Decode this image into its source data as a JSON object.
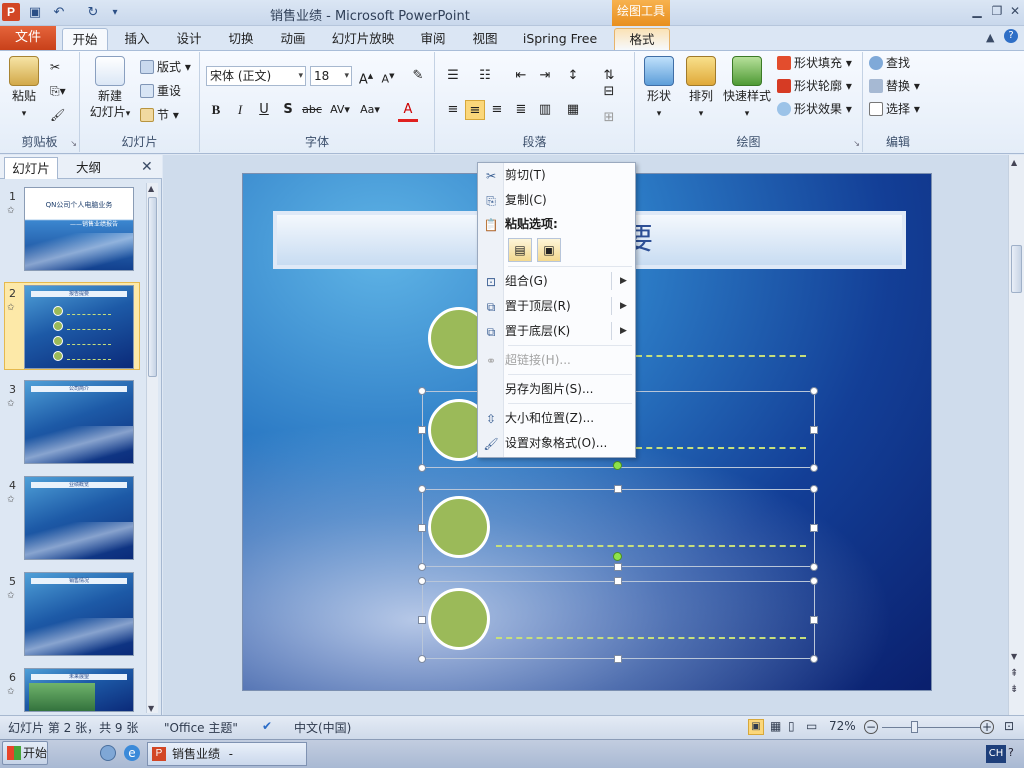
{
  "window": {
    "title": "销售业绩 - Microsoft PowerPoint",
    "context_tab": "绘图工具"
  },
  "tabs": {
    "file": "文件",
    "home": "开始",
    "insert": "插入",
    "design": "设计",
    "transitions": "切换",
    "animations": "动画",
    "slideshow": "幻灯片放映",
    "review": "审阅",
    "view": "视图",
    "ispring": "iSpring Free",
    "format": "格式"
  },
  "ribbon": {
    "clipboard": {
      "label": "剪贴板",
      "paste": "粘贴"
    },
    "slides": {
      "label": "幻灯片",
      "new_slide_1": "新建",
      "new_slide_2": "幻灯片",
      "layout": "版式",
      "reset": "重设",
      "section": "节"
    },
    "font": {
      "label": "字体",
      "font_name": "宋体 (正文)",
      "font_size": "18"
    },
    "paragraph": {
      "label": "段落"
    },
    "drawing": {
      "label": "绘图",
      "shapes": "形状",
      "arrange": "排列",
      "quick_styles": "快速样式",
      "shape_fill": "形状填充",
      "shape_outline": "形状轮廓",
      "shape_effects": "形状效果"
    },
    "editing": {
      "label": "编辑",
      "find": "查找",
      "replace": "替换",
      "select": "选择"
    }
  },
  "pane": {
    "tab_slides": "幻灯片",
    "tab_outline": "大纲"
  },
  "thumbnails": [
    {
      "num": "1",
      "title": "QN公司个人电脑业务",
      "subtitle": "——销售业绩报告"
    },
    {
      "num": "2",
      "title": "报告提要"
    },
    {
      "num": "3",
      "title": "公司简介"
    },
    {
      "num": "4",
      "title": "业绩概览"
    },
    {
      "num": "5",
      "title": "销售情况"
    },
    {
      "num": "6",
      "title": "未来展望"
    }
  ],
  "slide": {
    "title": "要"
  },
  "context_menu": {
    "cut": "剪切(T)",
    "copy": "复制(C)",
    "paste_options": "粘贴选项:",
    "group": "组合(G)",
    "bring_front": "置于顶层(R)",
    "send_back": "置于底层(K)",
    "hyperlink": "超链接(H)...",
    "save_as_picture": "另存为图片(S)...",
    "size_position": "大小和位置(Z)...",
    "format_object": "设置对象格式(O)..."
  },
  "status": {
    "slide_info": "幻灯片 第 2 张，共 9 张",
    "theme": "\"Office 主题\"",
    "language": "中文(中国)",
    "zoom": "72%"
  },
  "taskbar": {
    "start": "开始",
    "task": "销售业绩 - Microsof...",
    "ime": "CH"
  }
}
